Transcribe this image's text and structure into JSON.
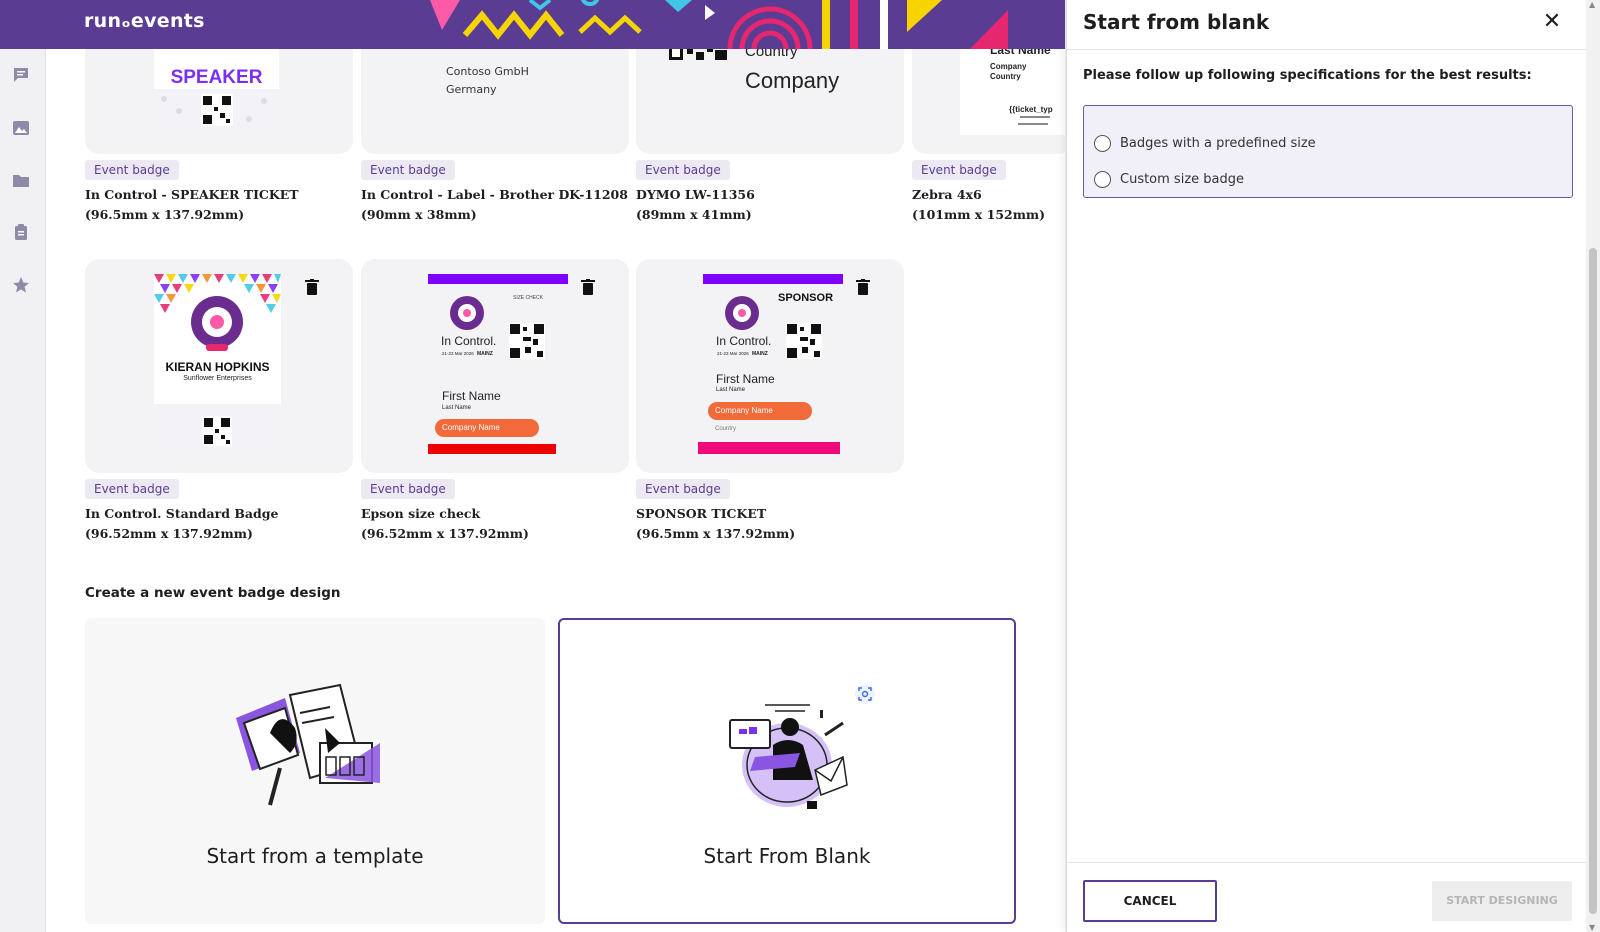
{
  "app": {
    "logo": "runₒevents",
    "accent": "#5a3d92"
  },
  "sidebar": {
    "icons": [
      "chat-icon",
      "image-icon",
      "folder-icon",
      "clipboard-icon",
      "star-icon"
    ]
  },
  "top_templates": [
    {
      "tag": "Event badge",
      "name": "In Control - SPEAKER TICKET",
      "size": "(96.5mm x 137.92mm)",
      "preview": {
        "role": "SPEAKER"
      }
    },
    {
      "tag": "Event badge",
      "name": "In Control - Label - Brother DK-11208",
      "size": "(90mm x 38mm)",
      "preview": {
        "company": "Contoso GmbH",
        "country": "Germany"
      }
    },
    {
      "tag": "Event badge",
      "name": "DYMO LW-11356",
      "size": "(89mm x 41mm)",
      "preview": {
        "country": "Country",
        "company": "Company"
      }
    },
    {
      "tag": "Event badge",
      "name": "Zebra 4x6",
      "size": "(101mm x 152mm)",
      "preview": {
        "last_name": "Last Name",
        "company": "Company",
        "country": "Country",
        "ticket": "{{ticket_typ"
      }
    }
  ],
  "bottom_templates": [
    {
      "tag": "Event badge",
      "name": "In Control. Standard Badge",
      "size": "(96.52mm x 137.92mm)",
      "preview": {
        "person": "KIERAN HOPKINS",
        "org": "Sunflower Enterprises"
      }
    },
    {
      "tag": "Event badge",
      "name": "Epson size check",
      "size": "(96.52mm x 137.92mm)",
      "preview": {
        "note": "SIZE CHECK",
        "brand": "In Control.",
        "date": "21-23 Mar 2026",
        "city": "MAINZ",
        "first_name": "First Name",
        "last_name": "Last Name",
        "company": "Company Name"
      }
    },
    {
      "tag": "Event badge",
      "name": "SPONSOR TICKET",
      "size": "(96.5mm x 137.92mm)",
      "preview": {
        "role": "SPONSOR",
        "brand": "In Control.",
        "date": "21-23 Mar 2026",
        "city": "MAINZ",
        "first_name": "First Name",
        "last_name": "Last Name",
        "company": "Company Name",
        "country": "Country"
      }
    }
  ],
  "create_section": {
    "title": "Create a new event badge design",
    "options": [
      {
        "label": "Start from a template"
      },
      {
        "label": "Start From Blank",
        "selected": true
      }
    ]
  },
  "panel": {
    "title": "Start from blank",
    "instruction": "Please follow up following specifications for the best results:",
    "radio_options": [
      "Badges with a predefined size",
      "Custom size badge"
    ],
    "cancel_label": "CANCEL",
    "start_label": "START DESIGNING"
  }
}
